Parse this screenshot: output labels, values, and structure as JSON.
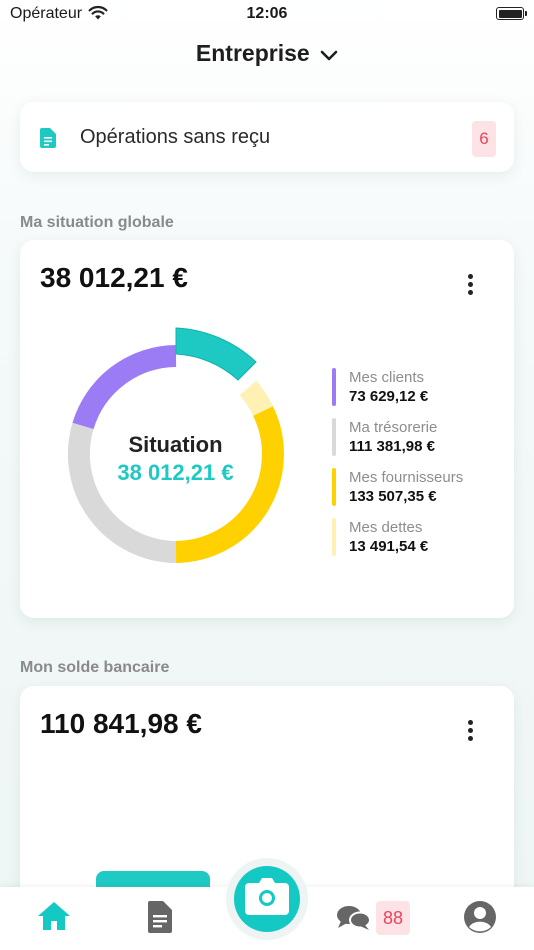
{
  "status_bar": {
    "carrier": "Opérateur",
    "time": "12:06"
  },
  "header": {
    "title": "Entreprise"
  },
  "operations": {
    "label": "Opérations sans reçu",
    "count": "6"
  },
  "situation": {
    "section_title": "Ma situation globale",
    "amount": "38 012,21 €",
    "center_label": "Situation",
    "center_value": "38 012,21 €",
    "legend": [
      {
        "name": "Mes clients",
        "value": "73 629,12 €",
        "color": "#9b7cf4"
      },
      {
        "name": "Ma trésorerie",
        "value": "111 381,98 €",
        "color": "#d9d9d9"
      },
      {
        "name": "Mes fournisseurs",
        "value": "133 507,35 €",
        "color": "#ffd100"
      },
      {
        "name": "Mes dettes",
        "value": "13 491,54 €",
        "color": "#fff0b3"
      }
    ],
    "highlight_color": "#1ec9c3"
  },
  "solde": {
    "section_title": "Mon solde bancaire",
    "amount": "110 841,98 €"
  },
  "tabbar": {
    "items": [
      "home-icon",
      "document-icon",
      "camera-icon",
      "chat-icon",
      "profile-icon"
    ],
    "messages_badge": "88",
    "accent": "#14c9c3"
  }
}
